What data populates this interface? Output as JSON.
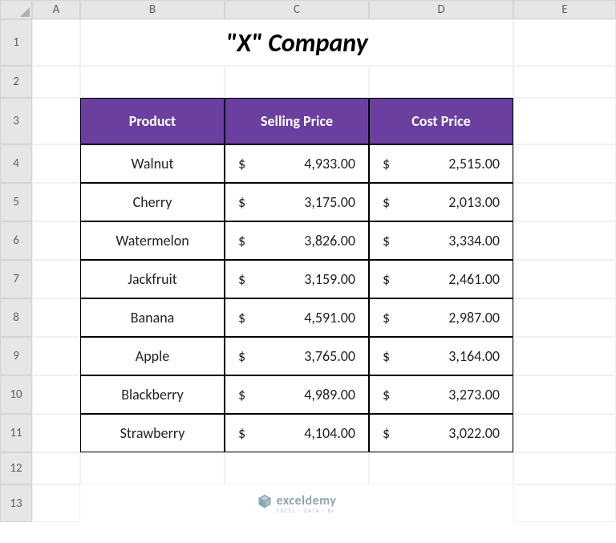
{
  "columns": [
    "A",
    "B",
    "C",
    "D",
    "E"
  ],
  "rows": [
    "1",
    "2",
    "3",
    "4",
    "5",
    "6",
    "7",
    "8",
    "9",
    "10",
    "11",
    "12",
    "13"
  ],
  "title": "\"X\" Company",
  "headers": {
    "product": "Product",
    "selling": "Selling Price",
    "cost": "Cost Price"
  },
  "currency": "$",
  "data": [
    {
      "product": "Walnut",
      "selling": "4,933.00",
      "cost": "2,515.00"
    },
    {
      "product": "Cherry",
      "selling": "3,175.00",
      "cost": "2,013.00"
    },
    {
      "product": "Watermelon",
      "selling": "3,826.00",
      "cost": "3,334.00"
    },
    {
      "product": "Jackfruit",
      "selling": "3,159.00",
      "cost": "2,461.00"
    },
    {
      "product": "Banana",
      "selling": "4,591.00",
      "cost": "2,987.00"
    },
    {
      "product": "Apple",
      "selling": "3,765.00",
      "cost": "3,164.00"
    },
    {
      "product": "Blackberry",
      "selling": "4,989.00",
      "cost": "3,273.00"
    },
    {
      "product": "Strawberry",
      "selling": "4,104.00",
      "cost": "3,022.00"
    }
  ],
  "watermark": {
    "brand": "exceldemy",
    "tagline": "EXCEL · DATA · BI"
  }
}
